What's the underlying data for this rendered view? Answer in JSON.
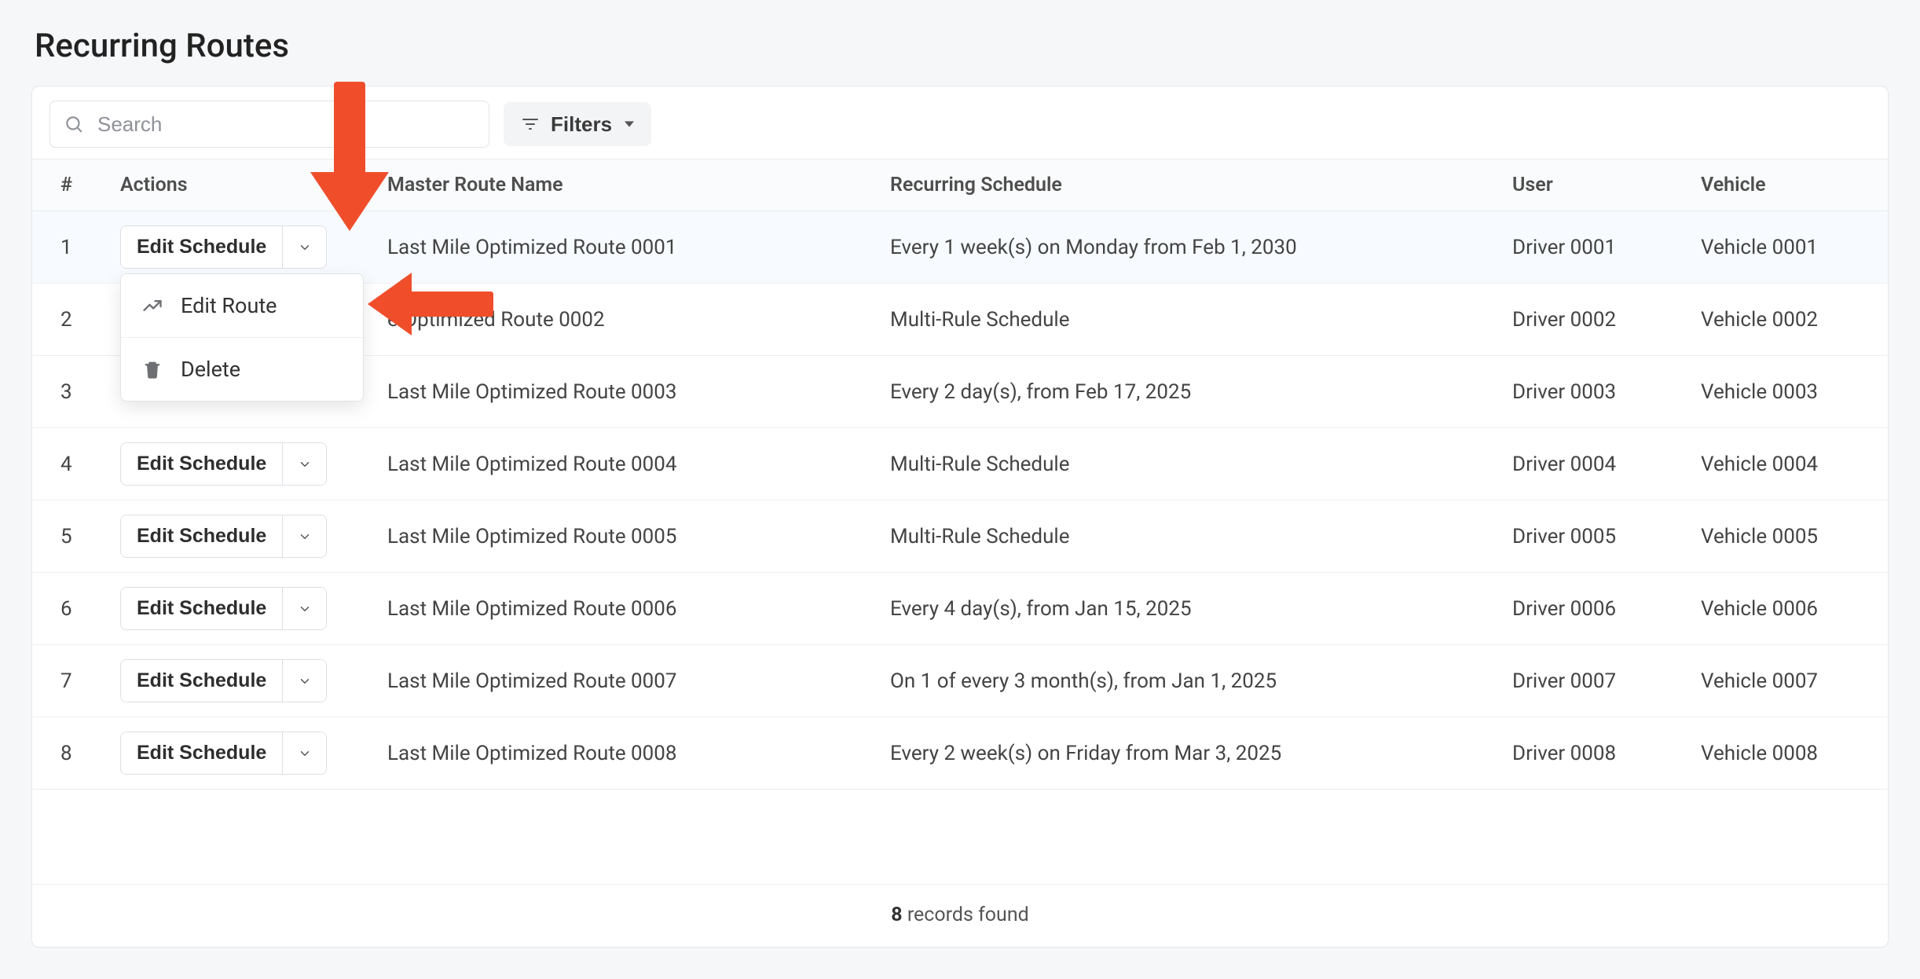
{
  "page_title": "Recurring Routes",
  "search": {
    "placeholder": "Search"
  },
  "filters_button": {
    "label": "Filters"
  },
  "columns": {
    "num": "#",
    "actions": "Actions",
    "name": "Master Route Name",
    "schedule": "Recurring Schedule",
    "user": "User",
    "vehicle": "Vehicle"
  },
  "action_button_label": "Edit Schedule",
  "dropdown": {
    "edit_route": "Edit Route",
    "delete": "Delete"
  },
  "rows": [
    {
      "num": "1",
      "name": "Last Mile Optimized Route 0001",
      "schedule": "Every 1 week(s) on Monday from Feb 1, 2030",
      "user": "Driver 0001",
      "vehicle": "Vehicle 0001"
    },
    {
      "num": "2",
      "name": "e Optimized Route 0002",
      "schedule": "Multi-Rule Schedule",
      "user": "Driver 0002",
      "vehicle": "Vehicle 0002"
    },
    {
      "num": "3",
      "name": "Last Mile Optimized Route 0003",
      "schedule": "Every 2 day(s), from Feb 17, 2025",
      "user": "Driver 0003",
      "vehicle": "Vehicle 0003"
    },
    {
      "num": "4",
      "name": "Last Mile Optimized Route 0004",
      "schedule": "Multi-Rule Schedule",
      "user": "Driver 0004",
      "vehicle": "Vehicle 0004"
    },
    {
      "num": "5",
      "name": "Last Mile Optimized Route 0005",
      "schedule": "Multi-Rule Schedule",
      "user": "Driver 0005",
      "vehicle": "Vehicle 0005"
    },
    {
      "num": "6",
      "name": "Last Mile Optimized Route 0006",
      "schedule": "Every 4 day(s), from Jan 15, 2025",
      "user": "Driver 0006",
      "vehicle": "Vehicle 0006"
    },
    {
      "num": "7",
      "name": "Last Mile Optimized Route 0007",
      "schedule": "On 1 of every 3 month(s), from Jan 1, 2025",
      "user": "Driver 0007",
      "vehicle": "Vehicle 0007"
    },
    {
      "num": "8",
      "name": "Last Mile Optimized Route 0008",
      "schedule": "Every 2 week(s) on Friday from Mar 3, 2025",
      "user": "Driver 0008",
      "vehicle": "Vehicle 0008"
    }
  ],
  "footer": {
    "count": "8",
    "label": "records found"
  },
  "colors": {
    "arrow": "#f04e2b"
  }
}
